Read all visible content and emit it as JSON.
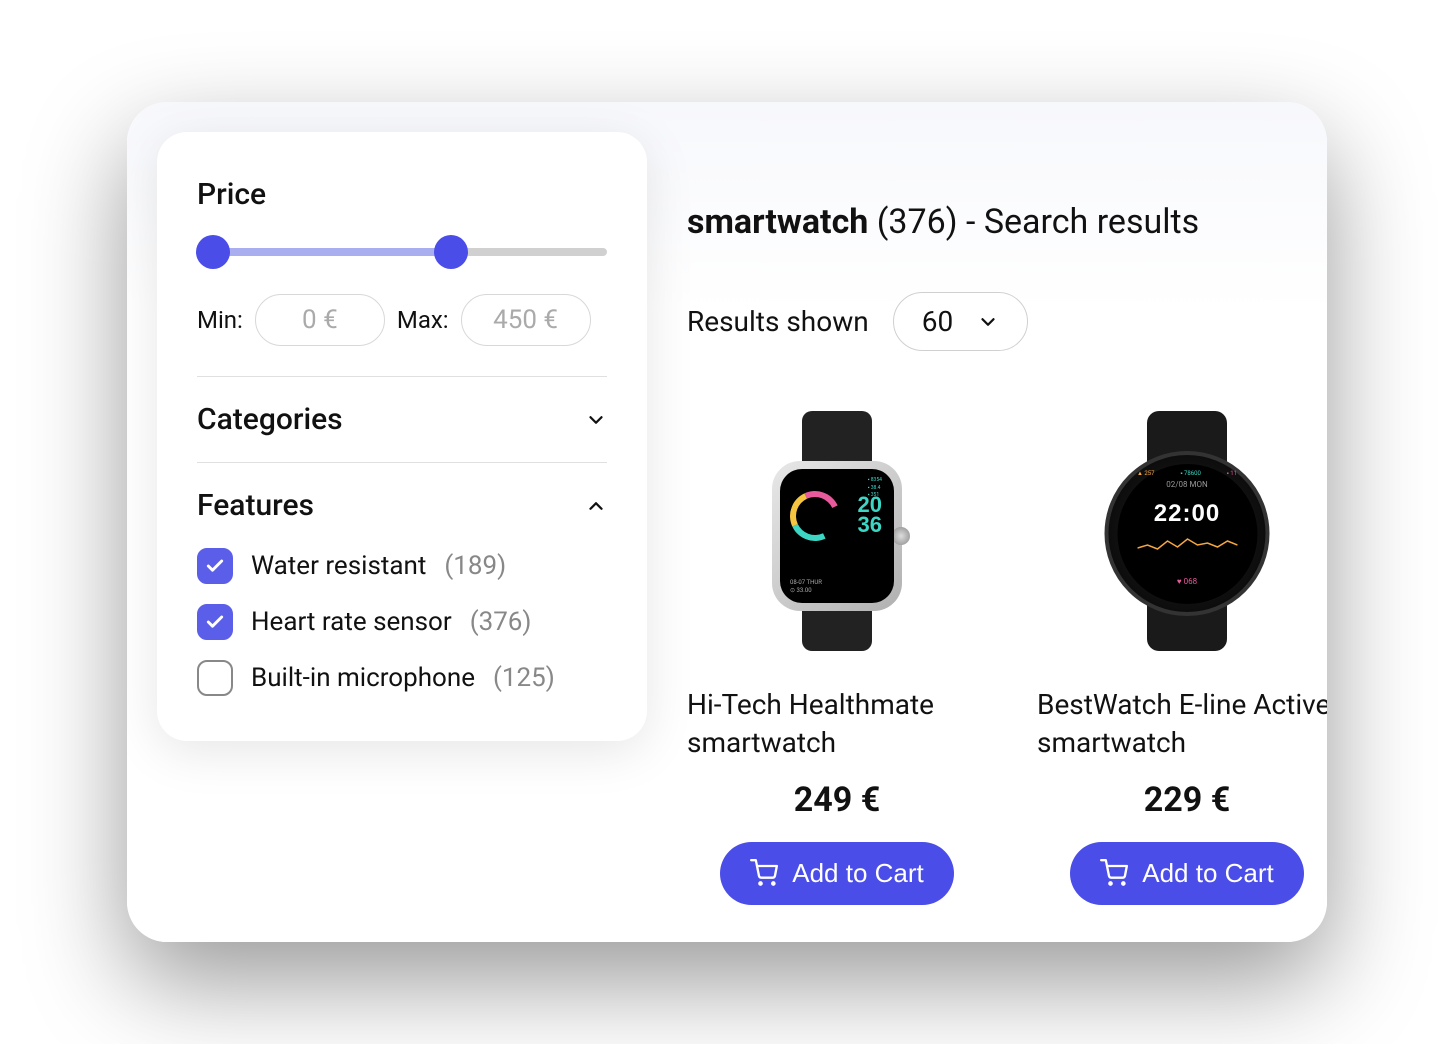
{
  "sidebar": {
    "price": {
      "title": "Price",
      "min_label": "Min:",
      "max_label": "Max:",
      "min_value": "0 €",
      "max_value": "450 €"
    },
    "categories": {
      "title": "Categories",
      "expanded": false
    },
    "features": {
      "title": "Features",
      "expanded": true,
      "items": [
        {
          "label": "Water resistant",
          "count": "(189)",
          "checked": true
        },
        {
          "label": "Heart rate sensor",
          "count": "(376)",
          "checked": true
        },
        {
          "label": "Built-in microphone",
          "count": "(125)",
          "checked": false
        }
      ]
    }
  },
  "main": {
    "search_term": "smartwatch",
    "result_count": "(376)",
    "title_suffix": " - Search results",
    "results_shown_label": "Results shown",
    "results_shown_value": "60",
    "add_to_cart_label": "Add to Cart",
    "products": [
      {
        "name": "Hi-Tech Healthmate smartwatch",
        "price": "249 €"
      },
      {
        "name": "BestWatch E-line Active smartwatch",
        "price": "229 €"
      }
    ]
  }
}
